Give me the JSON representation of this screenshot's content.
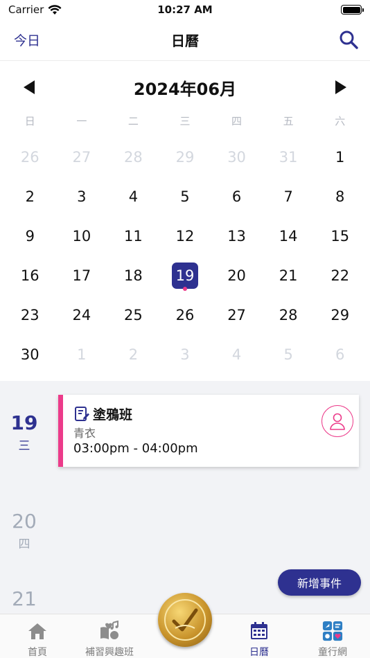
{
  "status": {
    "carrier": "Carrier",
    "time": "10:27 AM"
  },
  "nav": {
    "today_label": "今日",
    "title": "日曆"
  },
  "calendar": {
    "month_label": "2024年06月",
    "weekdays": [
      "日",
      "一",
      "二",
      "三",
      "四",
      "五",
      "六"
    ],
    "days": [
      {
        "d": "26",
        "muted": true
      },
      {
        "d": "27",
        "muted": true
      },
      {
        "d": "28",
        "muted": true
      },
      {
        "d": "29",
        "muted": true
      },
      {
        "d": "30",
        "muted": true
      },
      {
        "d": "31",
        "muted": true
      },
      {
        "d": "1"
      },
      {
        "d": "2"
      },
      {
        "d": "3"
      },
      {
        "d": "4"
      },
      {
        "d": "5"
      },
      {
        "d": "6"
      },
      {
        "d": "7"
      },
      {
        "d": "8"
      },
      {
        "d": "9"
      },
      {
        "d": "10"
      },
      {
        "d": "11"
      },
      {
        "d": "12"
      },
      {
        "d": "13"
      },
      {
        "d": "14"
      },
      {
        "d": "15"
      },
      {
        "d": "16"
      },
      {
        "d": "17"
      },
      {
        "d": "18"
      },
      {
        "d": "19",
        "selected": true,
        "event": true
      },
      {
        "d": "20"
      },
      {
        "d": "21"
      },
      {
        "d": "22"
      },
      {
        "d": "23"
      },
      {
        "d": "24"
      },
      {
        "d": "25"
      },
      {
        "d": "26"
      },
      {
        "d": "27"
      },
      {
        "d": "28"
      },
      {
        "d": "29"
      },
      {
        "d": "30"
      },
      {
        "d": "1",
        "muted": true
      },
      {
        "d": "2",
        "muted": true
      },
      {
        "d": "3",
        "muted": true
      },
      {
        "d": "4",
        "muted": true
      },
      {
        "d": "5",
        "muted": true
      },
      {
        "d": "6",
        "muted": true
      }
    ]
  },
  "agenda": {
    "dates": [
      {
        "num": "19",
        "weekday": "三"
      },
      {
        "num": "20",
        "weekday": "四"
      },
      {
        "num": "21",
        "weekday": ""
      }
    ],
    "event": {
      "title": "塗鴉班",
      "subtitle": "青衣",
      "time": "03:00pm - 04:00pm"
    },
    "add_label": "新增事件"
  },
  "tabs": {
    "home": "首頁",
    "classes": "補習興趣班",
    "calendar": "日曆",
    "network": "童行網"
  },
  "colors": {
    "primary": "#2e3190",
    "accent": "#ec3b8a",
    "muted": "#d3d7de"
  },
  "icons": {
    "nav": "search-icon",
    "calendar": [
      "chevron-left-icon",
      "chevron-right-icon"
    ],
    "event": [
      "note-edit-icon",
      "person-icon"
    ],
    "tabs": [
      "home-icon",
      "classes-icon",
      "gold-badge-icon",
      "calendar-icon",
      "network-icon"
    ]
  }
}
